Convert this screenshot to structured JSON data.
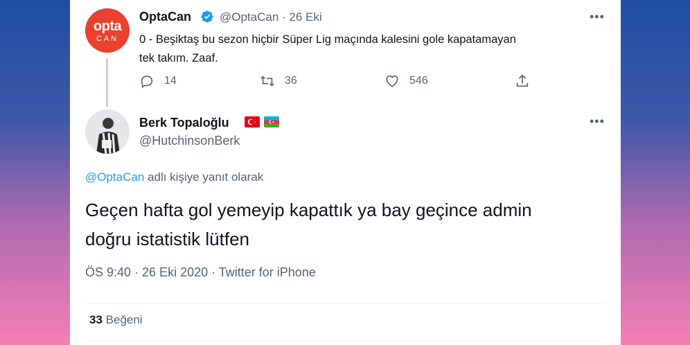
{
  "colors": {
    "brand": "#1d9bf0",
    "opta_red": "#e9412e",
    "side_gradient_top": "#1e4ea3",
    "side_gradient_bottom": "#f47fb3"
  },
  "quoted_tweet": {
    "avatar_line1": "opta",
    "avatar_line2": "CAN",
    "name": "OptaCan",
    "handle_date": "@OptaCan · 26 Eki",
    "text_line1": "0 - Beşiktaş bu sezon hiçbir Süper Lig maçında kalesini gole kapatamayan",
    "text_line2": "tek takım. Zaaf.",
    "replies": "14",
    "retweets": "36",
    "likes": "546",
    "more": "•••"
  },
  "main_tweet": {
    "name": "Berk Topaloğlu",
    "handle": "@HutchinsonBerk",
    "more": "•••",
    "reply_mention": "@OptaCan",
    "reply_suffix": " adlı kişiye yanıt olarak",
    "text_line1": "Geçen hafta gol yemeyip kapattık ya bay geçince admin",
    "text_line2": "doğru istatistik lütfen",
    "meta": "ÖS 9:40 · 26 Eki 2020 · Twitter for iPhone",
    "like_count": "33",
    "like_label": " Beğeni"
  },
  "icons": [
    "verified-icon",
    "reply-icon",
    "retweet-icon",
    "like-icon",
    "share-icon",
    "more-icon",
    "turkey-flag-icon",
    "azerbaijan-flag-icon"
  ]
}
